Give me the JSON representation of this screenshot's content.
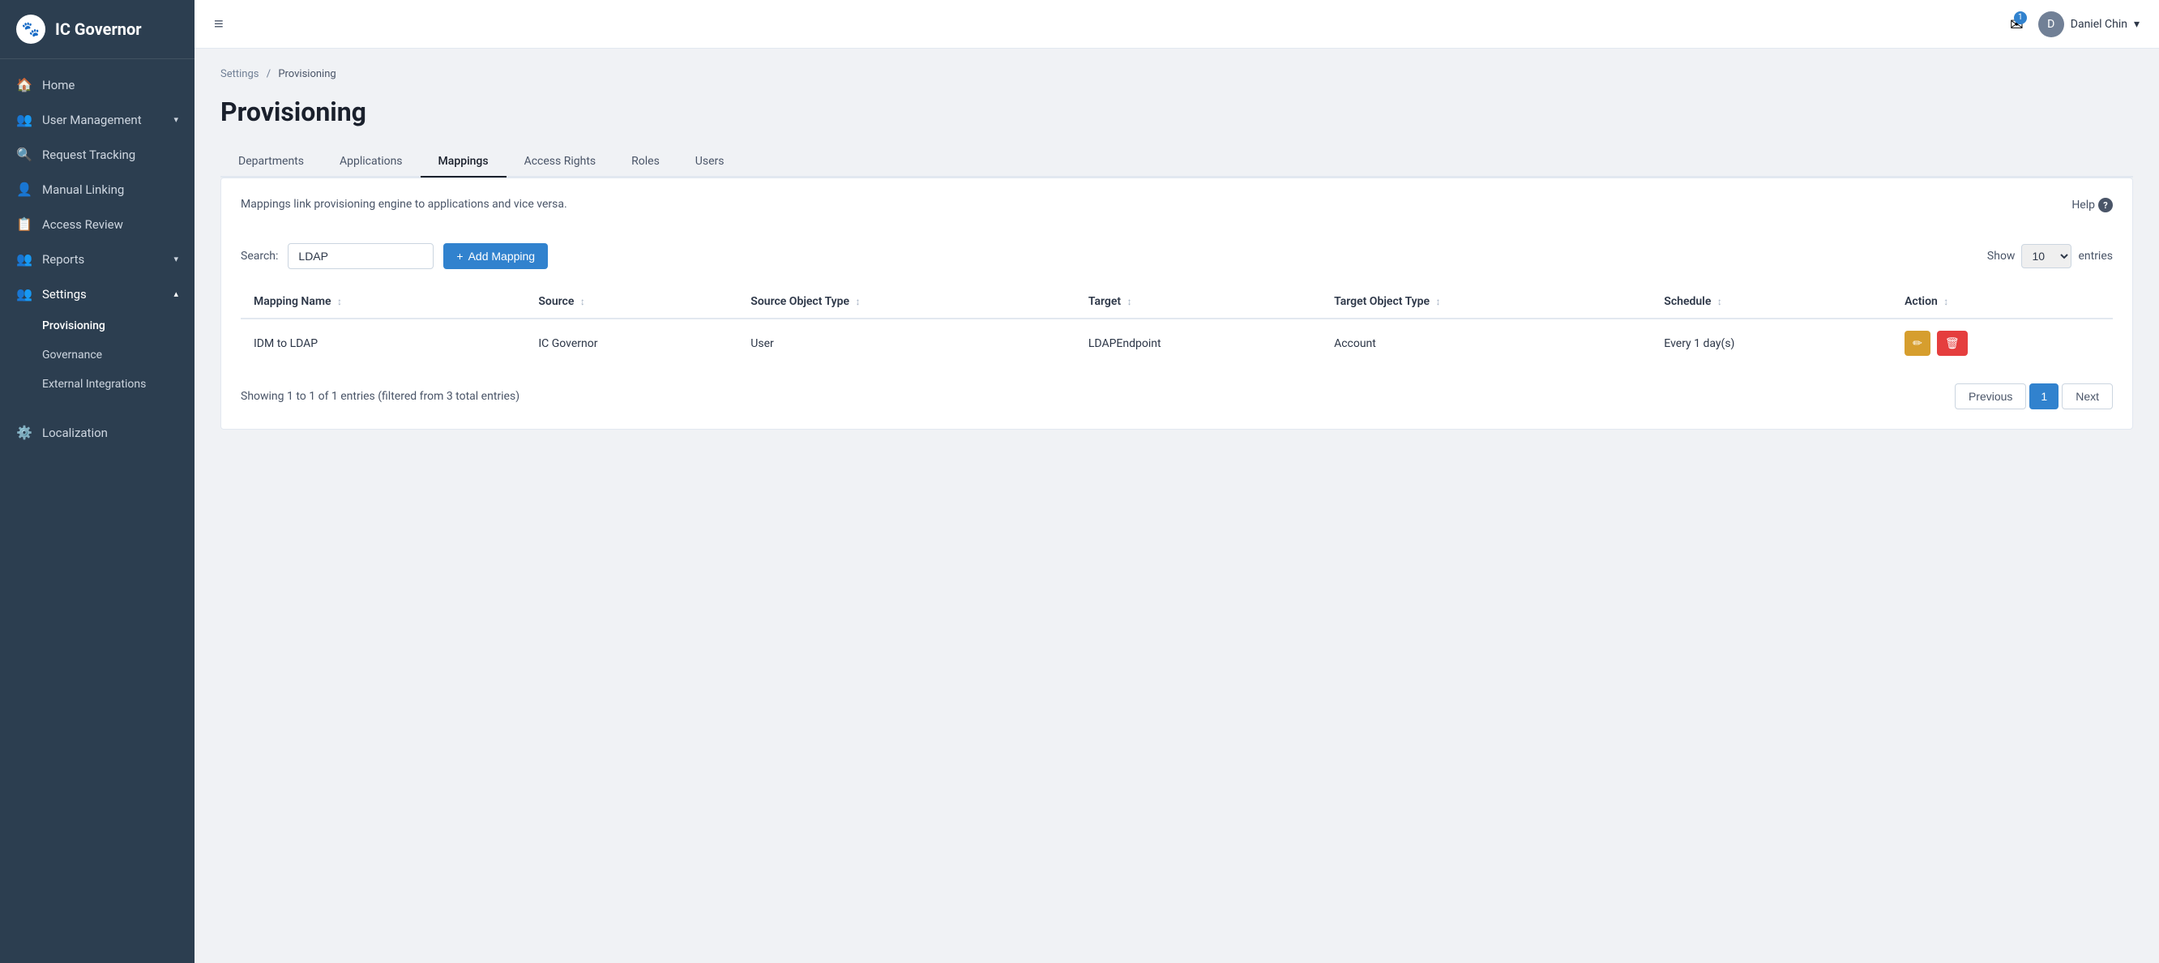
{
  "app": {
    "logo_text": "IC Governor",
    "logo_icon": "🐾"
  },
  "sidebar": {
    "items": [
      {
        "id": "home",
        "label": "Home",
        "icon": "🏠",
        "has_chevron": false
      },
      {
        "id": "user-management",
        "label": "User Management",
        "icon": "👥",
        "has_chevron": true
      },
      {
        "id": "request-tracking",
        "label": "Request Tracking",
        "icon": "🔍",
        "has_chevron": false
      },
      {
        "id": "manual-linking",
        "label": "Manual Linking",
        "icon": "👤",
        "has_chevron": false
      },
      {
        "id": "access-review",
        "label": "Access Review",
        "icon": "📋",
        "has_chevron": false
      },
      {
        "id": "reports",
        "label": "Reports",
        "icon": "👥",
        "has_chevron": true
      },
      {
        "id": "settings",
        "label": "Settings",
        "icon": "👥",
        "has_chevron": true,
        "active": true
      }
    ],
    "settings_subitems": [
      {
        "id": "provisioning",
        "label": "Provisioning",
        "active": true
      },
      {
        "id": "governance",
        "label": "Governance",
        "active": false
      },
      {
        "id": "external-integrations",
        "label": "External Integrations",
        "active": false
      }
    ],
    "bottom_items": [
      {
        "id": "localization",
        "label": "Localization",
        "icon": "⚙️"
      }
    ]
  },
  "topbar": {
    "menu_icon": "≡",
    "notification_count": "1",
    "user_name": "Daniel Chin",
    "user_initial": "D",
    "chevron": "▾"
  },
  "breadcrumb": {
    "parent": "Settings",
    "separator": "/",
    "current": "Provisioning"
  },
  "page": {
    "title": "Provisioning"
  },
  "tabs": [
    {
      "id": "departments",
      "label": "Departments",
      "active": false
    },
    {
      "id": "applications",
      "label": "Applications",
      "active": false
    },
    {
      "id": "mappings",
      "label": "Mappings",
      "active": true
    },
    {
      "id": "access-rights",
      "label": "Access Rights",
      "active": false
    },
    {
      "id": "roles",
      "label": "Roles",
      "active": false
    },
    {
      "id": "users",
      "label": "Users",
      "active": false
    }
  ],
  "mappings": {
    "description": "Mappings link provisioning engine to applications and vice versa.",
    "help_label": "Help",
    "search_label": "Search:",
    "search_value": "LDAP",
    "add_button_label": "+ Add Mapping",
    "show_label": "Show",
    "entries_label": "entries",
    "entries_value": "10",
    "columns": [
      {
        "id": "mapping-name",
        "label": "Mapping Name"
      },
      {
        "id": "source",
        "label": "Source"
      },
      {
        "id": "source-object-type",
        "label": "Source Object Type"
      },
      {
        "id": "target",
        "label": "Target"
      },
      {
        "id": "target-object-type",
        "label": "Target Object Type"
      },
      {
        "id": "schedule",
        "label": "Schedule"
      },
      {
        "id": "action",
        "label": "Action"
      }
    ],
    "rows": [
      {
        "mapping_name": "IDM to LDAP",
        "source": "IC Governor",
        "source_object_type": "User",
        "target": "LDAPEndpoint",
        "target_object_type": "Account",
        "schedule": "Every 1 day(s)"
      }
    ],
    "pagination": {
      "info": "Showing 1 to 1 of 1 entries (filtered from 3 total entries)",
      "previous_label": "Previous",
      "current_page": "1",
      "next_label": "Next"
    }
  }
}
